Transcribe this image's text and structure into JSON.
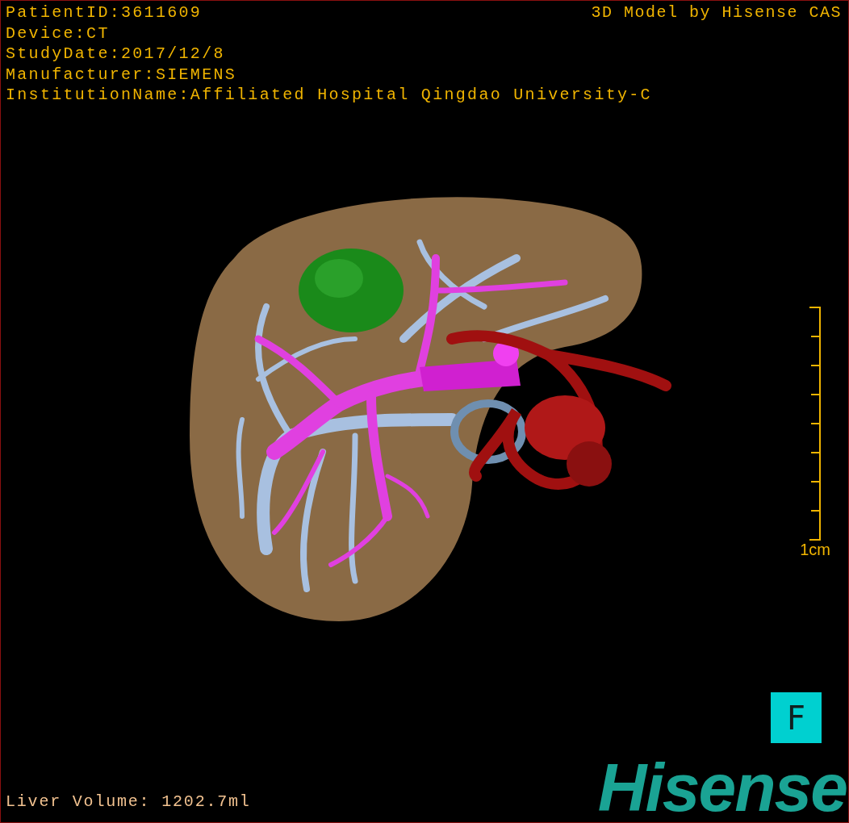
{
  "info_lines": [
    "PatientID:3611609",
    "Device:CT",
    "StudyDate:2017/12/8",
    "Manufacturer:SIEMENS",
    "InstitutionName:Affiliated Hospital Qingdao University-C"
  ],
  "title": "3D Model by Hisense CAS",
  "scale_bar": {
    "label": "1cm"
  },
  "view_orientation": "F",
  "footer": {
    "liver_volume": "Liver Volume: 1202.7ml",
    "logo": "Hisense"
  }
}
